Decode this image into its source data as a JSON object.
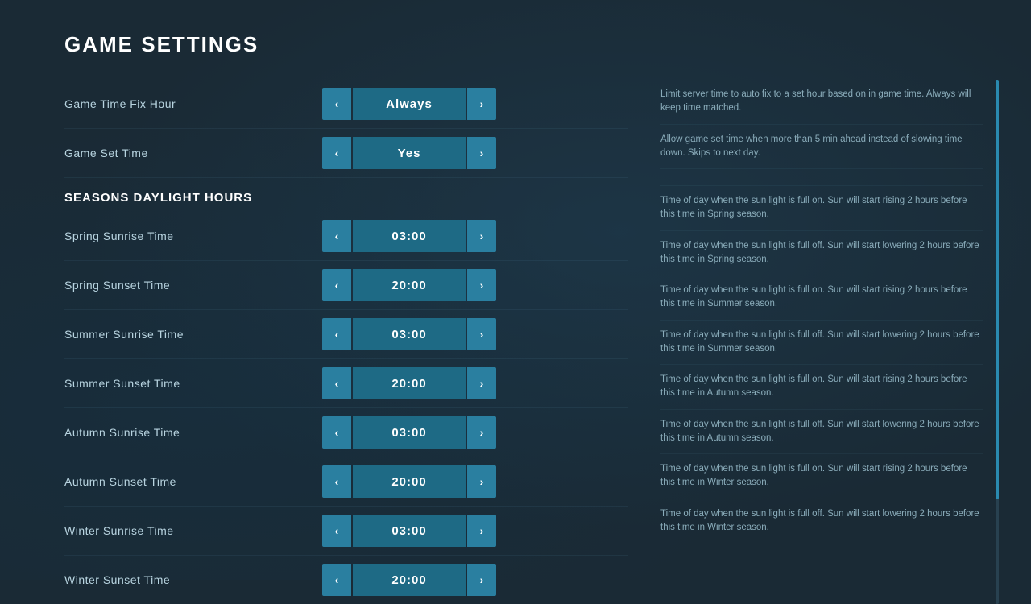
{
  "page": {
    "title": "GAME SETTINGS"
  },
  "settings": [
    {
      "id": "game-time-fix-hour",
      "label": "Game Time Fix Hour",
      "value": "Always",
      "description": "Limit server time to auto fix to a set hour based on in game time.  Always will keep time matched."
    },
    {
      "id": "game-set-time",
      "label": "Game Set Time",
      "value": "Yes",
      "description": "Allow game set time when more than 5 min ahead instead of slowing time down.  Skips to next day."
    }
  ],
  "section_header": "SEASONS DAYLIGHT HOURS",
  "season_settings": [
    {
      "id": "spring-sunrise",
      "label": "Spring Sunrise Time",
      "value": "03:00",
      "description": "Time of day when the sun light is full on.  Sun will start rising 2 hours before this time in Spring season."
    },
    {
      "id": "spring-sunset",
      "label": "Spring Sunset Time",
      "value": "20:00",
      "description": "Time of day when the sun light is full off.  Sun will start lowering 2 hours before this time in Spring season."
    },
    {
      "id": "summer-sunrise",
      "label": "Summer Sunrise Time",
      "value": "03:00",
      "description": "Time of day when the sun light is full on.  Sun will start rising 2 hours before this time in Summer season."
    },
    {
      "id": "summer-sunset",
      "label": "Summer Sunset Time",
      "value": "20:00",
      "description": "Time of day when the sun light is full off.  Sun will start lowering 2 hours before this time in Summer season."
    },
    {
      "id": "autumn-sunrise",
      "label": "Autumn Sunrise Time",
      "value": "03:00",
      "description": "Time of day when the sun light is full on.  Sun will start rising 2 hours before this time in Autumn season."
    },
    {
      "id": "autumn-sunset",
      "label": "Autumn Sunset Time",
      "value": "20:00",
      "description": "Time of day when the sun light is full off.  Sun will start lowering 2 hours before this time in Autumn season."
    },
    {
      "id": "winter-sunrise",
      "label": "Winter Sunrise Time",
      "value": "03:00",
      "description": "Time of day when the sun light is full on.  Sun will start rising 2 hours before this time in Winter season."
    },
    {
      "id": "winter-sunset",
      "label": "Winter Sunset Time",
      "value": "20:00",
      "description": "Time of day when the sun light is full off.  Sun will start lowering 2 hours before this time in Winter season."
    }
  ],
  "buttons": {
    "left_arrow": "‹",
    "right_arrow": "›"
  }
}
